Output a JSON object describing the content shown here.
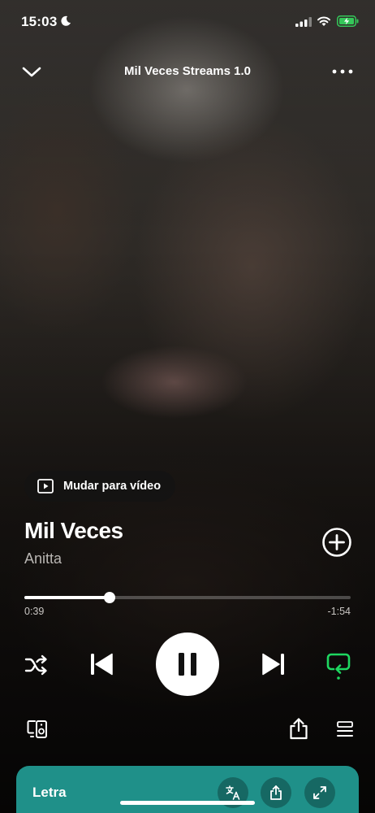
{
  "status_bar": {
    "time": "15:03"
  },
  "header": {
    "title": "Mil Veces Streams 1.0"
  },
  "video_switch": {
    "label": "Mudar para vídeo"
  },
  "track": {
    "title": "Mil Veces",
    "artist": "Anitta"
  },
  "playback": {
    "elapsed": "0:39",
    "remaining": "-1:54",
    "progress": 0.26,
    "state": "playing"
  },
  "lyrics_card": {
    "label": "Letra"
  },
  "colors": {
    "accent_green": "#1ed760",
    "lyrics_teal": "#1f9089",
    "battery_green": "#34c759"
  },
  "icons": {
    "status": [
      "moon-icon",
      "signal-icon",
      "wifi-icon",
      "battery-charging-icon"
    ],
    "header": [
      "chevron-down-icon",
      "more-dots-icon"
    ],
    "controls": [
      "shuffle-icon",
      "previous-icon",
      "pause-icon",
      "next-icon",
      "repeat-icon"
    ],
    "bottom": [
      "devices-icon",
      "share-icon",
      "queue-icon"
    ],
    "lyrics": [
      "translate-icon",
      "share-icon",
      "expand-icon"
    ]
  }
}
